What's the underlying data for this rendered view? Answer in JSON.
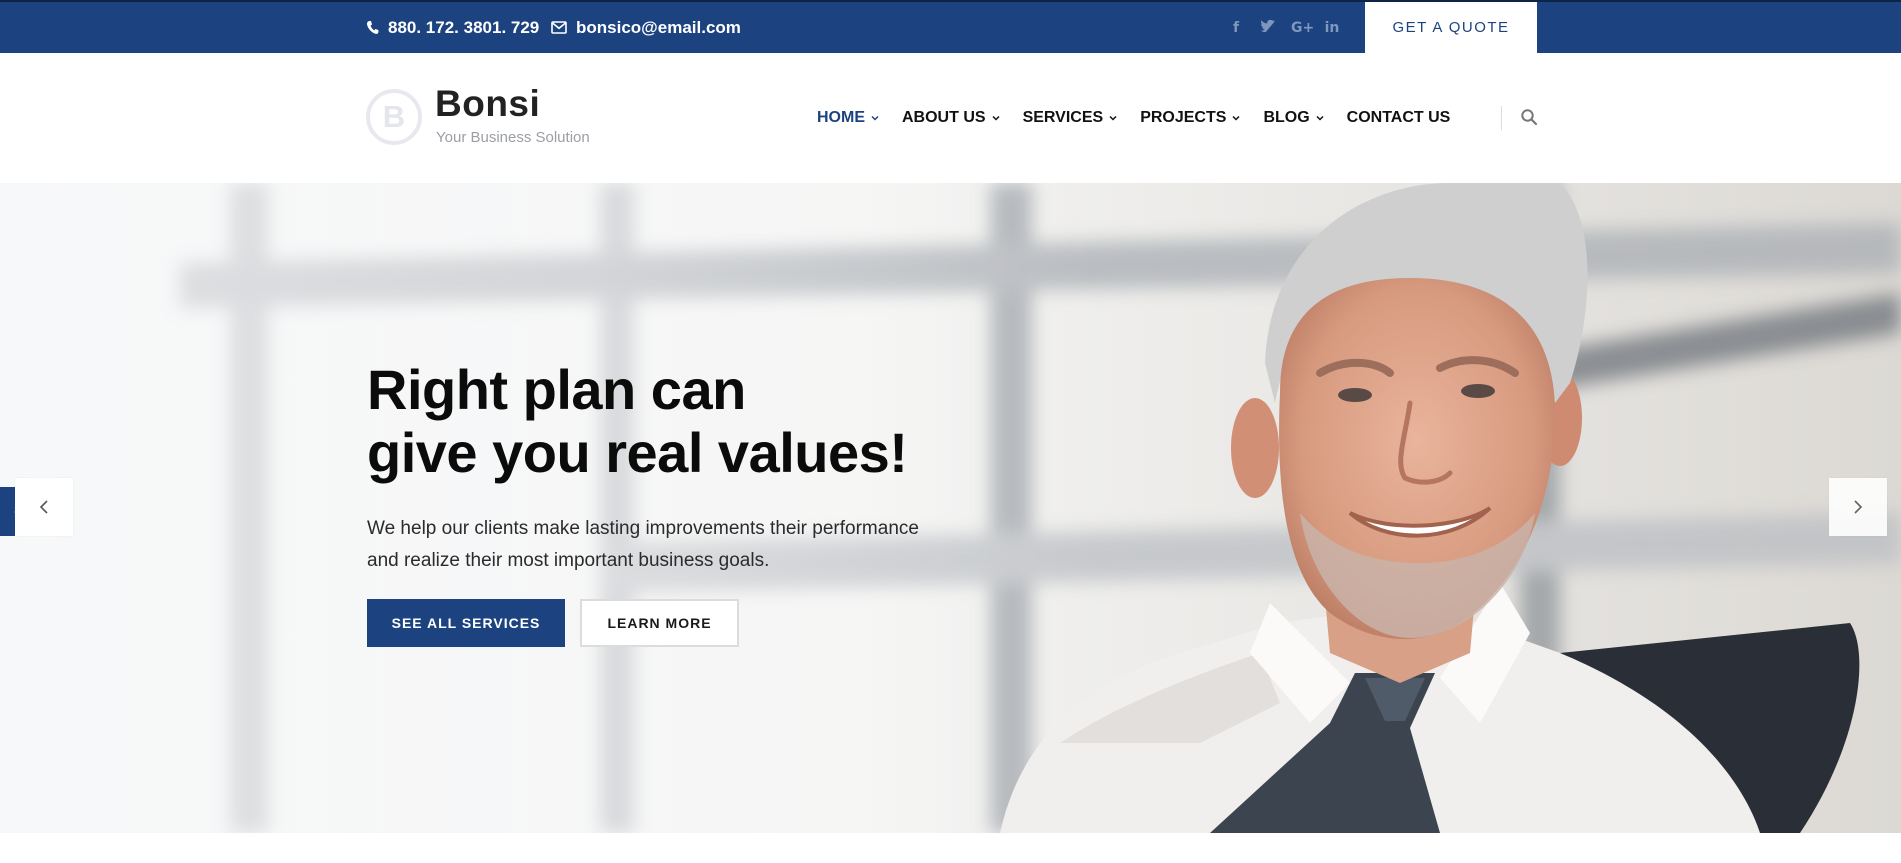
{
  "topbar": {
    "phone": "880. 172. 3801. 729",
    "email": "bonsico@email.com",
    "socials": [
      {
        "icon": "facebook-icon",
        "glyph": "f"
      },
      {
        "icon": "twitter-icon",
        "glyph": "t"
      },
      {
        "icon": "google-plus-icon",
        "glyph": "G+"
      },
      {
        "icon": "linkedin-icon",
        "glyph": "in"
      }
    ],
    "quote_label": "GET A QUOTE"
  },
  "header": {
    "logo_letter": "B",
    "brand_name": "Bonsi",
    "tagline": "Your Business Solution",
    "nav": [
      {
        "label": "HOME",
        "has_dropdown": true,
        "active": true
      },
      {
        "label": "ABOUT US",
        "has_dropdown": true,
        "active": false
      },
      {
        "label": "SERVICES",
        "has_dropdown": true,
        "active": false
      },
      {
        "label": "PROJECTS",
        "has_dropdown": true,
        "active": false
      },
      {
        "label": "BLOG",
        "has_dropdown": true,
        "active": false
      },
      {
        "label": "CONTACT US",
        "has_dropdown": false,
        "active": false
      }
    ]
  },
  "hero": {
    "title_line1": "Right plan can",
    "title_line2": "give you real values!",
    "text_line1": "We help our clients make lasting improvements their performance",
    "text_line2": "and realize their most important business goals.",
    "primary_button": "SEE ALL SERVICES",
    "secondary_button": "LEARN MORE"
  },
  "colors": {
    "brand_blue": "#1c4380",
    "topbar_social": "#7f96bd",
    "heading": "#0b0b0b"
  }
}
